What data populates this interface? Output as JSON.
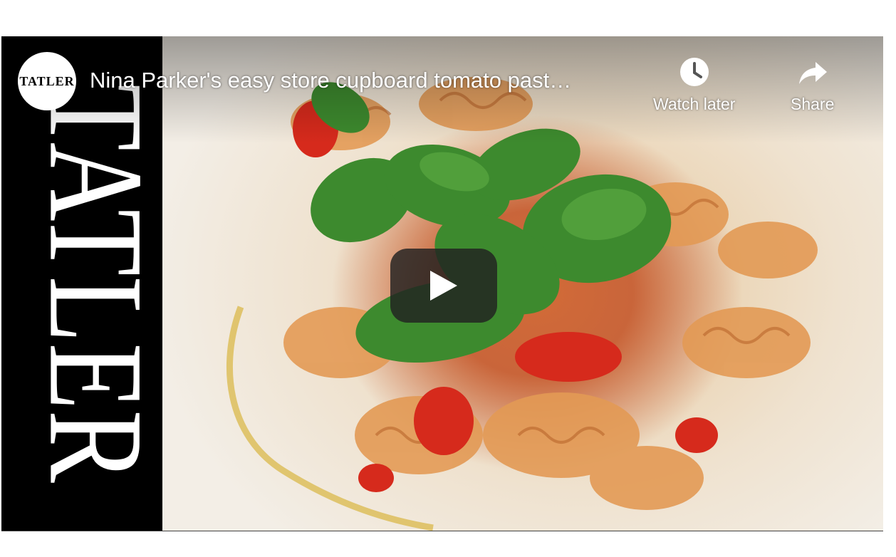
{
  "video": {
    "title": "Nina Parker's easy store cupboard tomato past…",
    "channel_avatar_text": "TATLER",
    "brand_text": "TATLER"
  },
  "controls": {
    "watch_later_label": "Watch later",
    "share_label": "Share"
  },
  "icons": {
    "watch_later": "clock-icon",
    "share": "share-arrow-icon",
    "play": "play-icon"
  },
  "colors": {
    "play_button_bg": "#212121",
    "brand_strip": "#000000",
    "text": "#ffffff"
  }
}
